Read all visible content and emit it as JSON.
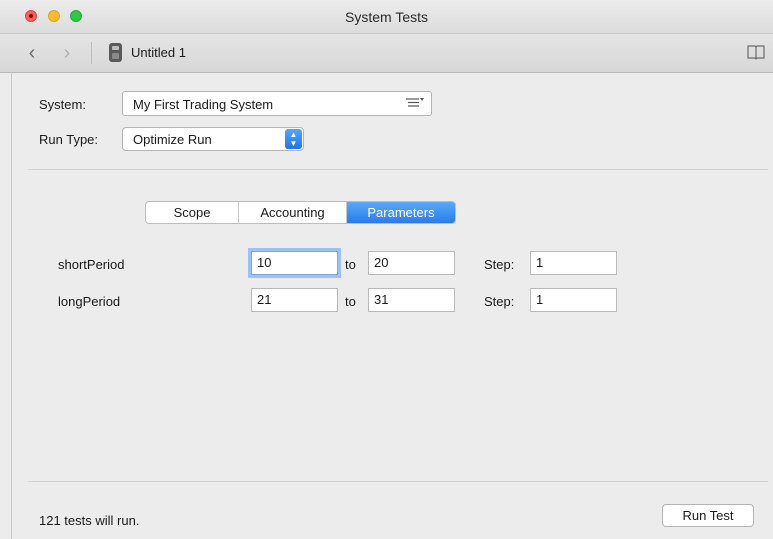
{
  "window": {
    "title": "System Tests"
  },
  "toolbar": {
    "document_title": "Untitled 1"
  },
  "form": {
    "system_label": "System:",
    "system_value": "My First Trading System",
    "run_type_label": "Run Type:",
    "run_type_value": "Optimize Run"
  },
  "tabs": [
    {
      "label": "Scope",
      "active": false
    },
    {
      "label": "Accounting",
      "active": false
    },
    {
      "label": "Parameters",
      "active": true
    }
  ],
  "parameters": [
    {
      "name": "shortPeriod",
      "from": "10",
      "to": "20",
      "step": "1"
    },
    {
      "name": "longPeriod",
      "from": "21",
      "to": "31",
      "step": "1"
    }
  ],
  "labels": {
    "to": "to",
    "step": "Step:"
  },
  "status": "121 tests will run.",
  "run_button": "Run Test",
  "colors": {
    "accent": "#2a7cec",
    "close": "#fc5f57",
    "minimize": "#fdbc2e",
    "zoom": "#33c748"
  }
}
